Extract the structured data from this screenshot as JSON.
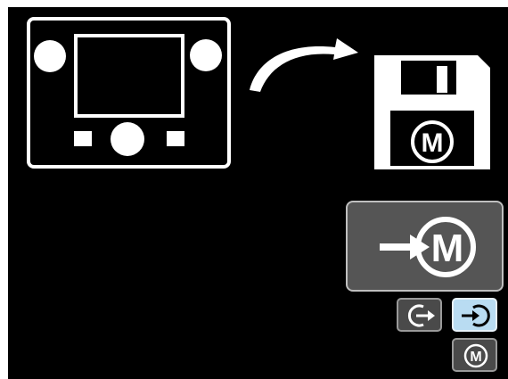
{
  "icons": {
    "device": "welder-front-panel-icon",
    "arrow": "curved-arrow-icon",
    "save": "floppy-disk-icon",
    "recall": "recall-memory-icon",
    "exit": "exit-icon",
    "enter": "enter-icon",
    "memory": "memory-icon"
  },
  "labels": {
    "floppy_memory": "M",
    "recall_memory": "M",
    "memory_button": "M"
  },
  "colors": {
    "background": "#000000",
    "card": "#555555",
    "selected": "#b9dcf2"
  }
}
